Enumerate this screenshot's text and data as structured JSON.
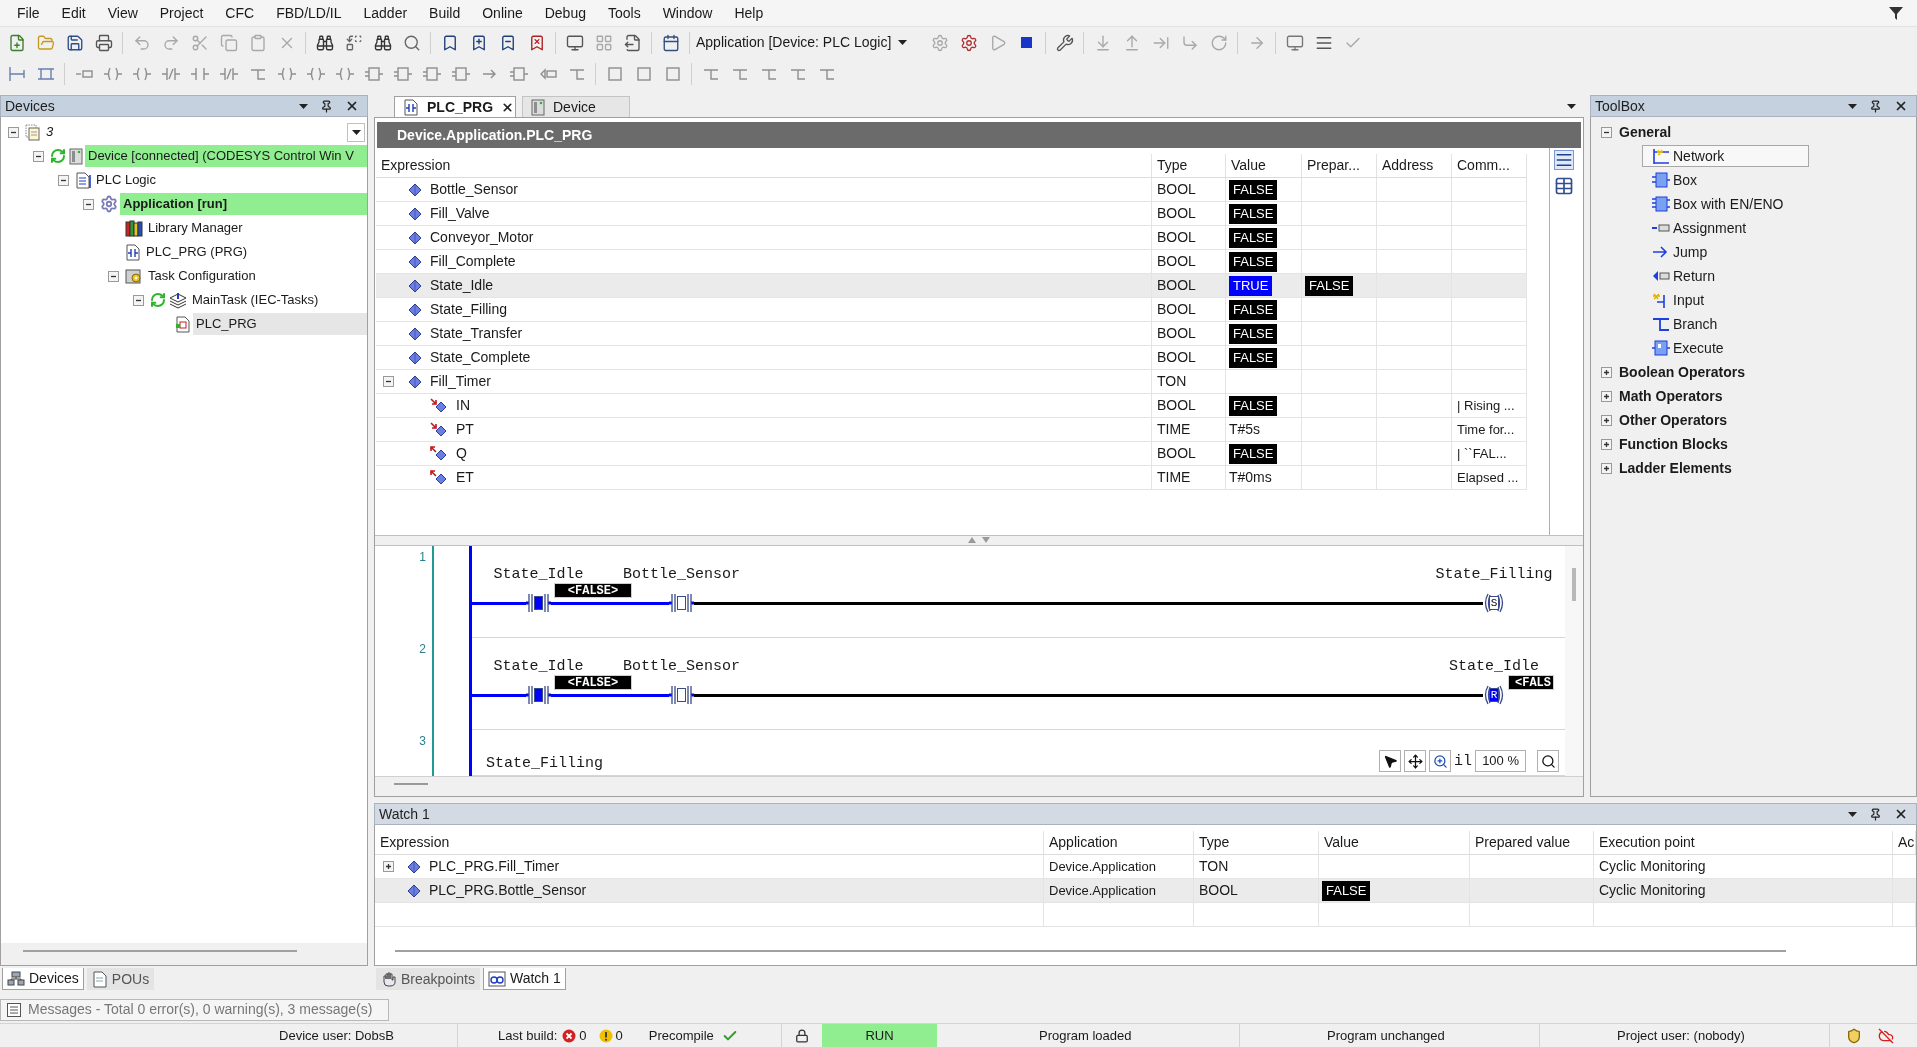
{
  "menu": [
    "File",
    "Edit",
    "View",
    "Project",
    "CFC",
    "FBD/LD/IL",
    "Ladder",
    "Build",
    "Online",
    "Debug",
    "Tools",
    "Window",
    "Help"
  ],
  "toolbar": {
    "application": "Application [Device: PLC Logic]"
  },
  "devices_panel": {
    "title": "Devices",
    "tree": [
      {
        "label": "3",
        "kind": "project",
        "expanded": true,
        "selected": false,
        "online": false,
        "active": false,
        "children": [
          {
            "label": "Device [connected] (CODESYS Control Win V",
            "kind": "device",
            "expanded": true,
            "selected": false,
            "online": true,
            "active": false,
            "children": [
              {
                "label": "PLC Logic",
                "kind": "plc-logic",
                "expanded": true,
                "selected": false,
                "online": false,
                "active": false,
                "children": [
                  {
                    "label": "Application [run]",
                    "kind": "application",
                    "expanded": true,
                    "selected": false,
                    "online": true,
                    "active": true,
                    "children": [
                      {
                        "label": "Library Manager",
                        "kind": "library",
                        "selected": false,
                        "online": false,
                        "active": false
                      },
                      {
                        "label": "PLC_PRG (PRG)",
                        "kind": "pou",
                        "selected": false,
                        "online": false,
                        "active": false
                      },
                      {
                        "label": "Task Configuration",
                        "kind": "task-configuration",
                        "expanded": true,
                        "selected": false,
                        "online": false,
                        "active": false,
                        "children": [
                          {
                            "label": "MainTask (IEC-Tasks)",
                            "kind": "task",
                            "expanded": true,
                            "selected": false,
                            "online": false,
                            "active": false,
                            "children": [
                              {
                                "label": "PLC_PRG",
                                "kind": "task-call",
                                "selected": true,
                                "online": false,
                                "active": false
                              }
                            ]
                          }
                        ]
                      }
                    ]
                  }
                ]
              }
            ]
          }
        ]
      }
    ],
    "tabs": [
      {
        "label": "Devices",
        "kind": "devices",
        "selected": true
      },
      {
        "label": "POUs",
        "kind": "pous",
        "selected": false
      }
    ]
  },
  "editor": {
    "tabs": [
      {
        "label": "PLC_PRG",
        "kind": "program",
        "selected": true
      },
      {
        "label": "Device",
        "kind": "device",
        "selected": false
      }
    ],
    "path": "Device.Application.PLC_PRG",
    "columns": [
      "Expression",
      "Type",
      "Value",
      "Prepar...",
      "Address",
      "Comm..."
    ],
    "rows": [
      {
        "expression": "Bottle_Sensor",
        "kind": "variable",
        "type": "BOOL",
        "value": {
          "text": "FALSE",
          "color": "#000000"
        },
        "selected": false
      },
      {
        "expression": "Fill_Valve",
        "kind": "variable",
        "type": "BOOL",
        "value": {
          "text": "FALSE",
          "color": "#000000"
        },
        "selected": false
      },
      {
        "expression": "Conveyor_Motor",
        "kind": "variable",
        "type": "BOOL",
        "value": {
          "text": "FALSE",
          "color": "#000000"
        },
        "selected": false
      },
      {
        "expression": "Fill_Complete",
        "kind": "variable",
        "type": "BOOL",
        "value": {
          "text": "FALSE",
          "color": "#000000"
        },
        "selected": false
      },
      {
        "expression": "State_Idle",
        "kind": "variable",
        "type": "BOOL",
        "value": {
          "text": "TRUE",
          "color": "#0000ff"
        },
        "prepared": {
          "text": "FALSE",
          "color": "#000000"
        },
        "selected": true
      },
      {
        "expression": "State_Filling",
        "kind": "variable",
        "type": "BOOL",
        "value": {
          "text": "FALSE",
          "color": "#000000"
        },
        "selected": false
      },
      {
        "expression": "State_Transfer",
        "kind": "variable",
        "type": "BOOL",
        "value": {
          "text": "FALSE",
          "color": "#000000"
        },
        "selected": false
      },
      {
        "expression": "State_Complete",
        "kind": "variable",
        "type": "BOOL",
        "value": {
          "text": "FALSE",
          "color": "#000000"
        },
        "selected": false
      },
      {
        "expression": "Fill_Timer",
        "kind": "variable",
        "type": "TON",
        "expanded": true,
        "selected": false,
        "children": [
          {
            "expression": "IN",
            "kind": "input",
            "type": "BOOL",
            "value": {
              "text": "FALSE",
              "color": "#000000"
            },
            "comment": "| Rising ...",
            "selected": false
          },
          {
            "expression": "PT",
            "kind": "input",
            "type": "TIME",
            "value": {
              "text": "T#5s"
            },
            "comment": "Time for...",
            "selected": false
          },
          {
            "expression": "Q",
            "kind": "output",
            "type": "BOOL",
            "value": {
              "text": "FALSE",
              "color": "#000000"
            },
            "comment": "| ``FAL...",
            "selected": false
          },
          {
            "expression": "ET",
            "kind": "output",
            "type": "TIME",
            "value": {
              "text": "T#0ms"
            },
            "comment": "Elapsed ...",
            "selected": false
          }
        ]
      }
    ]
  },
  "ladder": {
    "networks": [
      {
        "number": "1",
        "contacts": [
          {
            "name": "State_Idle",
            "on": true,
            "prepared": "<FALSE>"
          },
          {
            "name": "Bottle_Sensor",
            "on": false
          }
        ],
        "coil": {
          "name": "State_Filling",
          "letter": "S",
          "on": false
        }
      },
      {
        "number": "2",
        "contacts": [
          {
            "name": "State_Idle",
            "on": true,
            "prepared": "<FALSE>"
          },
          {
            "name": "Bottle_Sensor",
            "on": false
          }
        ],
        "coil": {
          "name": "State_Idle",
          "letter": "R",
          "on": true,
          "prepared": "<FALS"
        }
      },
      {
        "number": "3",
        "label": "State_Filling",
        "hidden_label": "il"
      }
    ],
    "zoom": "100 %"
  },
  "toolbox": {
    "title": "ToolBox",
    "groups": [
      {
        "label": "General",
        "expanded": true,
        "items": [
          {
            "label": "Network",
            "kind": "network",
            "selected": true
          },
          {
            "label": "Box",
            "kind": "box",
            "selected": false
          },
          {
            "label": "Box with EN/ENO",
            "kind": "box-en",
            "selected": false
          },
          {
            "label": "Assignment",
            "kind": "assignment",
            "selected": false
          },
          {
            "label": "Jump",
            "kind": "jump",
            "selected": false
          },
          {
            "label": "Return",
            "kind": "return",
            "selected": false
          },
          {
            "label": "Input",
            "kind": "input",
            "selected": false
          },
          {
            "label": "Branch",
            "kind": "branch",
            "selected": false
          },
          {
            "label": "Execute",
            "kind": "execute",
            "selected": false
          }
        ]
      },
      {
        "label": "Boolean Operators",
        "expanded": false
      },
      {
        "label": "Math Operators",
        "expanded": false
      },
      {
        "label": "Other Operators",
        "expanded": false
      },
      {
        "label": "Function Blocks",
        "expanded": false
      },
      {
        "label": "Ladder Elements",
        "expanded": false
      }
    ]
  },
  "watch": {
    "title": "Watch 1",
    "columns": [
      "Expression",
      "Application",
      "Type",
      "Value",
      "Prepared value",
      "Execution point",
      "Ac"
    ],
    "rows": [
      {
        "expression": "PLC_PRG.Fill_Timer",
        "application": "Device.Application",
        "type": "TON",
        "execution_point": "Cyclic Monitoring",
        "expanded": false,
        "selected": false
      },
      {
        "expression": "PLC_PRG.Bottle_Sensor",
        "application": "Device.Application",
        "type": "BOOL",
        "value": {
          "text": "FALSE",
          "color": "#000000"
        },
        "execution_point": "Cyclic Monitoring",
        "selected": true
      }
    ],
    "tabs": [
      {
        "label": "Breakpoints",
        "kind": "breakpoints",
        "selected": false
      },
      {
        "label": "Watch 1",
        "kind": "watch",
        "selected": true
      }
    ]
  },
  "messages": "Messages - Total 0 error(s), 0 warning(s), 3 message(s)",
  "status_bar": {
    "device_user": "Device user: DobsB",
    "last_build": {
      "label": "Last build:",
      "errors": "0",
      "warnings": "0"
    },
    "precompile": {
      "label": "Precompile",
      "ok": true
    },
    "run_state": {
      "label": "RUN",
      "running": true
    },
    "program_state": "Program loaded",
    "change_state": "Program unchanged",
    "project_user": "Project user: (nobody)"
  }
}
